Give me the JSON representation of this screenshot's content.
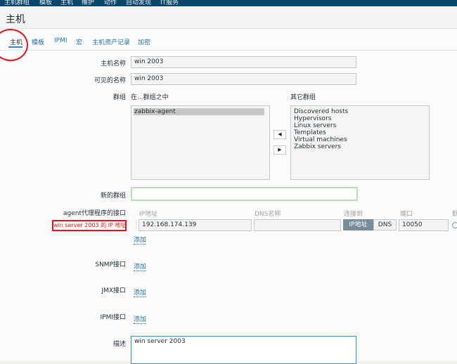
{
  "topbar": {
    "items": [
      "主机群组",
      "模板",
      "主机",
      "维护",
      "动作",
      "自动发现",
      "IT服务"
    ]
  },
  "header": {
    "title": "主机"
  },
  "tabs": [
    {
      "label": "主机",
      "active": true
    },
    {
      "label": "模板",
      "active": false
    },
    {
      "label": "IPMI",
      "active": false
    },
    {
      "label": "宏",
      "active": false
    },
    {
      "label": "主机资产记录",
      "active": false
    },
    {
      "label": "加密",
      "active": false
    }
  ],
  "form": {
    "hostname": {
      "label": "主机名称",
      "value": "win 2003"
    },
    "visible_name": {
      "label": "可见的名称",
      "value": "win 2003"
    },
    "groups": {
      "label": "群组",
      "in_groups_label": "在...群组之中",
      "other_groups_label": "其它群组",
      "in_groups": [
        "zabbix-agent"
      ],
      "other_groups": [
        "Discovered hosts",
        "Hypervisors",
        "Linux servers",
        "Templates",
        "Virtual machines",
        "Zabbix servers"
      ],
      "move_left": "◀",
      "move_right": "▶"
    },
    "new_group": {
      "label": "新的群组",
      "value": ""
    },
    "agent_interfaces": {
      "label": "agent代理程序的接口",
      "columns": {
        "ip": "IP地址",
        "dns": "DNS名称",
        "connect_to": "连接到",
        "port": "端口",
        "default": "默"
      },
      "ip": "192.168.174.139",
      "dns": "",
      "connect_ip": "IP地址",
      "connect_dns": "DNS",
      "port": "10050",
      "add": "添加"
    },
    "snmp": {
      "label": "SNMP接口",
      "add": "添加"
    },
    "jmx": {
      "label": "JMX接口",
      "add": "添加"
    },
    "ipmi": {
      "label": "IPMI接口",
      "add": "添加"
    },
    "description": {
      "label": "描述",
      "value": "win server 2003"
    }
  },
  "annotation": {
    "text": "win server 2003 的 IP 地址",
    "color": "#e5131a"
  },
  "colors": {
    "accent": "#1e71a4",
    "topbar": "#0a466a",
    "active_seg": "#768d99",
    "annotation": "#e5131a"
  }
}
